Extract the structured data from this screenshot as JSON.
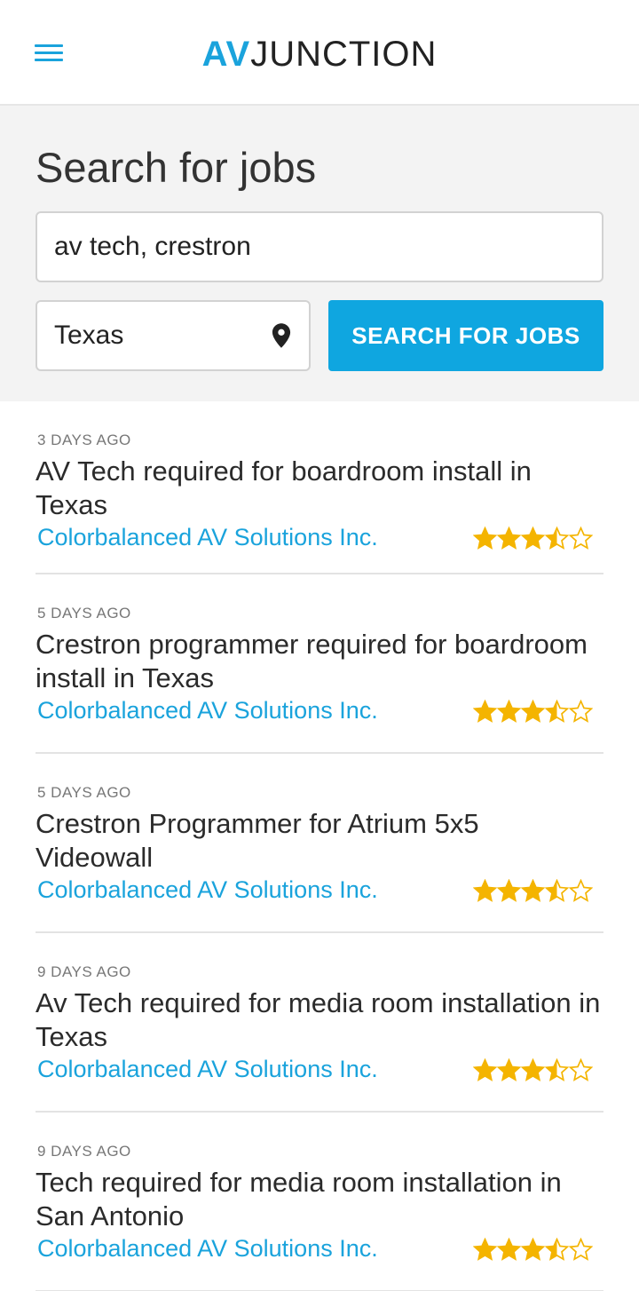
{
  "header": {
    "logo_av": "AV",
    "logo_junction": "JUNCTION"
  },
  "search": {
    "title": "Search for jobs",
    "keyword_value": "av tech, crestron",
    "location_value": "Texas",
    "button_label": "SEARCH FOR JOBS"
  },
  "colors": {
    "accent": "#1aa3dc",
    "button": "#0fa6e0",
    "star": "#f4b400"
  },
  "jobs": [
    {
      "age": "3 DAYS AGO",
      "title": "AV Tech required for boardroom install in Texas",
      "company": "Colorbalanced AV Solutions Inc.",
      "rating": 3.5,
      "rating_max": 5
    },
    {
      "age": "5 DAYS AGO",
      "title": "Crestron programmer required for boardroom install in Texas",
      "company": "Colorbalanced AV Solutions Inc.",
      "rating": 3.5,
      "rating_max": 5
    },
    {
      "age": "5 DAYS AGO",
      "title": "Crestron Programmer for Atrium 5x5 Videowall",
      "company": "Colorbalanced AV Solutions Inc.",
      "rating": 3.5,
      "rating_max": 5
    },
    {
      "age": "9 DAYS AGO",
      "title": "Av Tech required for media room installation in Texas",
      "company": "Colorbalanced AV Solutions Inc.",
      "rating": 3.5,
      "rating_max": 5
    },
    {
      "age": "9 DAYS AGO",
      "title": "Tech required for media room installation in San Antonio",
      "company": "Colorbalanced AV Solutions Inc.",
      "rating": 3.5,
      "rating_max": 5
    }
  ]
}
